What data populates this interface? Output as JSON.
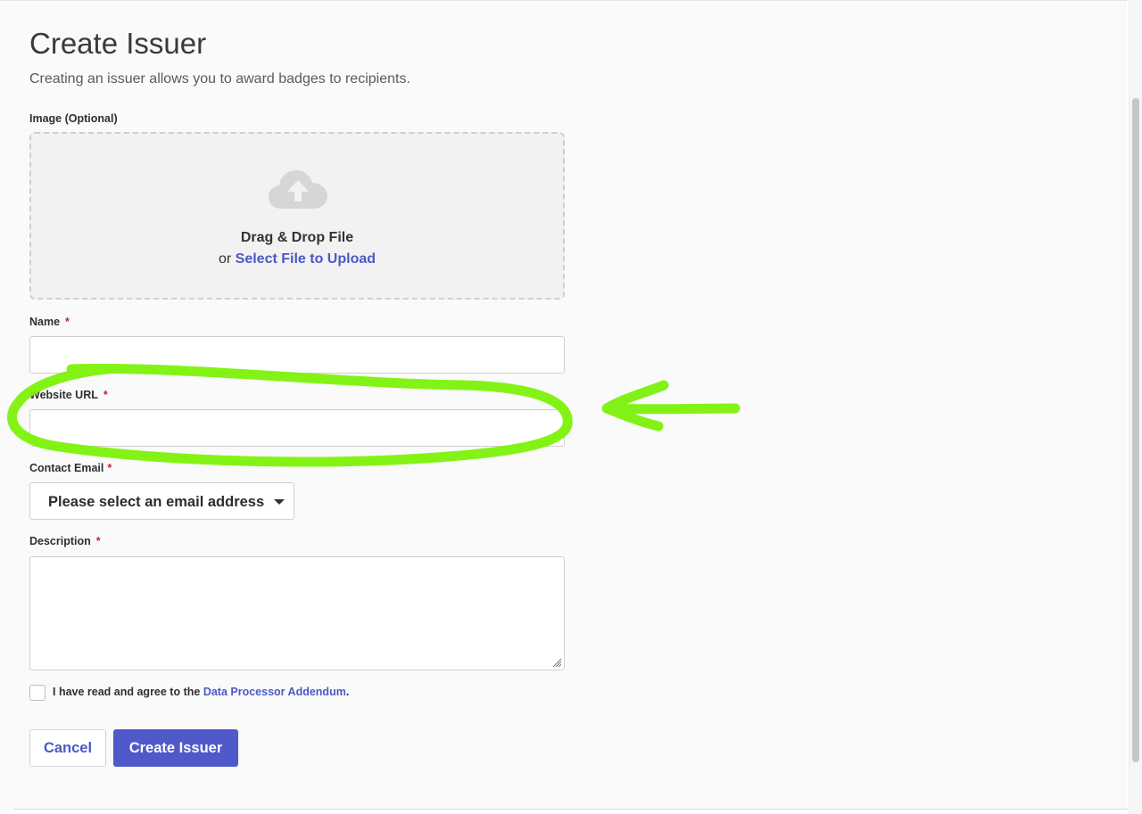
{
  "page": {
    "title": "Create Issuer",
    "subtitle": "Creating an issuer allows you to award badges to recipients."
  },
  "image_upload": {
    "label": "Image (Optional)",
    "drop_text": "Drag & Drop File",
    "or_text": "or",
    "select_link": "Select File to Upload",
    "icon": "cloud-upload-icon"
  },
  "fields": {
    "name": {
      "label": "Name",
      "required_mark": "*",
      "value": ""
    },
    "website_url": {
      "label": "Website URL",
      "required_mark": "*",
      "value": ""
    },
    "contact_email": {
      "label": "Contact Email",
      "required_mark": "*",
      "selected": "Please select an email address"
    },
    "description": {
      "label": "Description",
      "required_mark": "*",
      "value": ""
    }
  },
  "agreement": {
    "prefix": "I have read and agree to the",
    "link": "Data Processor Addendum",
    "suffix": ".",
    "checked": false
  },
  "buttons": {
    "cancel": "Cancel",
    "create": "Create Issuer"
  },
  "colors": {
    "accent": "#5059c9",
    "link": "#4a59c5",
    "required": "#c0282d",
    "annotation_highlight": "#7cf20a"
  }
}
